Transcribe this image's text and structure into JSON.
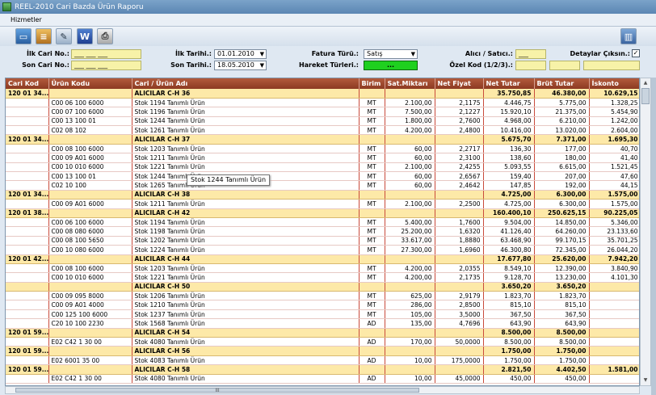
{
  "window": {
    "title": "REEL-2010 Cari Bazda Ürün Raporu"
  },
  "menu": {
    "item": "Hizmetler"
  },
  "filters": {
    "ilk_cari_label": "İlk Cari No.:",
    "ilk_cari_value": "___ ___ ___",
    "son_cari_label": "Son Cari No.:",
    "son_cari_value": "___ ___ ___",
    "ilk_tarih_label": "İlk Tarihi.:",
    "ilk_tarih_value": "01.01.2010",
    "son_tarih_label": "Son Tarihi.:",
    "son_tarih_value": "18.05.2010",
    "fatura_turu_label": "Fatura Türü.:",
    "fatura_turu_value": "Satış",
    "hareket_label": "Hareket Türleri.:",
    "hareket_button": "...",
    "alici_label": "Alıcı / Satıcı.:",
    "alici_value": "___",
    "ozel_kod_label": "Özel Kod (1/2/3).:",
    "detay_label": "Detaylar Çıksın.:",
    "detay_checked": "✓"
  },
  "columns": [
    "Cari Kod",
    "Ürün Kodu",
    "Cari / Ürün Adı",
    "Birim",
    "Sat.Miktarı",
    "Net Fiyat",
    "Net Tutar",
    "Brüt Tutar",
    "İskonto"
  ],
  "rows": [
    {
      "type": "group",
      "cari": "120 01 34...",
      "name": "ALICILAR C-H 36",
      "net": "35.750,85",
      "brut": "46.380,00",
      "isk": "10.629,15"
    },
    {
      "type": "item",
      "code": "C00 06 100 6000",
      "name": "Stok 1194 Tanımlı Ürün",
      "unit": "MT",
      "qty": "2.100,00",
      "price": "2,1175",
      "net": "4.446,75",
      "brut": "5.775,00",
      "isk": "1.328,25"
    },
    {
      "type": "item",
      "code": "C00 07 100 6000",
      "name": "Stok 1196 Tanımlı Ürün",
      "unit": "MT",
      "qty": "7.500,00",
      "price": "2,1227",
      "net": "15.920,10",
      "brut": "21.375,00",
      "isk": "5.454,90"
    },
    {
      "type": "item",
      "code": "C00 13 100 01",
      "name": "Stok 1244 Tanımlı Ürün",
      "unit": "MT",
      "qty": "1.800,00",
      "price": "2,7600",
      "net": "4.968,00",
      "brut": "6.210,00",
      "isk": "1.242,00"
    },
    {
      "type": "item",
      "code": "C02 08 102",
      "name": "Stok 1261 Tanımlı Ürün",
      "unit": "MT",
      "qty": "4.200,00",
      "price": "2,4800",
      "net": "10.416,00",
      "brut": "13.020,00",
      "isk": "2.604,00"
    },
    {
      "type": "group",
      "cari": "120 01 34...",
      "name": "ALICILAR C-H 37",
      "net": "5.675,70",
      "brut": "7.371,00",
      "isk": "1.695,30"
    },
    {
      "type": "item",
      "code": "C00 08 100 6000",
      "name": "Stok 1203 Tanımlı Ürün",
      "unit": "MT",
      "qty": "60,00",
      "price": "2,2717",
      "net": "136,30",
      "brut": "177,00",
      "isk": "40,70"
    },
    {
      "type": "item",
      "code": "C00 09 A01 6000",
      "name": "Stok 1211 Tanımlı Ürün",
      "unit": "MT",
      "qty": "60,00",
      "price": "2,3100",
      "net": "138,60",
      "brut": "180,00",
      "isk": "41,40"
    },
    {
      "type": "item",
      "code": "C00 10 010 6000",
      "name": "Stok 1221 Tanımlı Ürün",
      "unit": "MT",
      "qty": "2.100,00",
      "price": "2,4255",
      "net": "5.093,55",
      "brut": "6.615,00",
      "isk": "1.521,45"
    },
    {
      "type": "item",
      "code": "C00 13 100 01",
      "name": "Stok 1244 Tanımlı Ürün",
      "unit": "MT",
      "qty": "60,00",
      "price": "2,6567",
      "net": "159,40",
      "brut": "207,00",
      "isk": "47,60"
    },
    {
      "type": "item",
      "code": "C02 10 100",
      "name": "Stok 1265 Tanımlı Ürün",
      "unit": "MT",
      "qty": "60,00",
      "price": "2,4642",
      "net": "147,85",
      "brut": "192,00",
      "isk": "44,15"
    },
    {
      "type": "group",
      "cari": "120 01 34...",
      "name": "ALICILAR C-H 38",
      "net": "4.725,00",
      "brut": "6.300,00",
      "isk": "1.575,00"
    },
    {
      "type": "item",
      "code": "C00 09 A01 6000",
      "name": "Stok 1211 Tanımlı Ürün",
      "unit": "MT",
      "qty": "2.100,00",
      "price": "2,2500",
      "net": "4.725,00",
      "brut": "6.300,00",
      "isk": "1.575,00"
    },
    {
      "type": "group",
      "cari": "120 01 38...",
      "name": "ALICILAR C-H 42",
      "net": "160.400,10",
      "brut": "250.625,15",
      "isk": "90.225,05"
    },
    {
      "type": "item",
      "code": "C00 06 100 6000",
      "name": "Stok 1194 Tanımlı Ürün",
      "unit": "MT",
      "qty": "5.400,00",
      "price": "1,7600",
      "net": "9.504,00",
      "brut": "14.850,00",
      "isk": "5.346,00"
    },
    {
      "type": "item",
      "code": "C00 08 080 6000",
      "name": "Stok 1198 Tanımlı Ürün",
      "unit": "MT",
      "qty": "25.200,00",
      "price": "1,6320",
      "net": "41.126,40",
      "brut": "64.260,00",
      "isk": "23.133,60"
    },
    {
      "type": "item",
      "code": "C00 08 100 5650",
      "name": "Stok 1202 Tanımlı Ürün",
      "unit": "MT",
      "qty": "33.617,00",
      "price": "1,8880",
      "net": "63.468,90",
      "brut": "99.170,15",
      "isk": "35.701,25"
    },
    {
      "type": "item",
      "code": "C00 10 080 6000",
      "name": "Stok 1224 Tanımlı Ürün",
      "unit": "MT",
      "qty": "27.300,00",
      "price": "1,6960",
      "net": "46.300,80",
      "brut": "72.345,00",
      "isk": "26.044,20"
    },
    {
      "type": "group",
      "cari": "120 01 42...",
      "name": "ALICILAR C-H 44",
      "net": "17.677,80",
      "brut": "25.620,00",
      "isk": "7.942,20"
    },
    {
      "type": "item",
      "code": "C00 08 100 6000",
      "name": "Stok 1203 Tanımlı Ürün",
      "unit": "MT",
      "qty": "4.200,00",
      "price": "2,0355",
      "net": "8.549,10",
      "brut": "12.390,00",
      "isk": "3.840,90"
    },
    {
      "type": "item",
      "code": "C00 10 010 6000",
      "name": "Stok 1221 Tanımlı Ürün",
      "unit": "MT",
      "qty": "4.200,00",
      "price": "2,1735",
      "net": "9.128,70",
      "brut": "13.230,00",
      "isk": "4.101,30"
    },
    {
      "type": "group",
      "cari": "",
      "name": "ALICILAR C-H 50",
      "net": "3.650,20",
      "brut": "3.650,20",
      "isk": ""
    },
    {
      "type": "item",
      "code": "C00 09 095 8000",
      "name": "Stok 1206 Tanımlı Ürün",
      "unit": "MT",
      "qty": "625,00",
      "price": "2,9179",
      "net": "1.823,70",
      "brut": "1.823,70",
      "isk": ""
    },
    {
      "type": "item",
      "code": "C00 09 A01 4000",
      "name": "Stok 1210 Tanımlı Ürün",
      "unit": "MT",
      "qty": "286,00",
      "price": "2,8500",
      "net": "815,10",
      "brut": "815,10",
      "isk": ""
    },
    {
      "type": "item",
      "code": "C00 125 100 6000",
      "name": "Stok 1237 Tanımlı Ürün",
      "unit": "MT",
      "qty": "105,00",
      "price": "3,5000",
      "net": "367,50",
      "brut": "367,50",
      "isk": ""
    },
    {
      "type": "item",
      "code": "C20 10 100 2230",
      "name": "Stok 1568 Tanımlı Ürün",
      "unit": "AD",
      "qty": "135,00",
      "price": "4,7696",
      "net": "643,90",
      "brut": "643,90",
      "isk": ""
    },
    {
      "type": "group",
      "cari": "120 01 59...",
      "name": "ALICILAR C-H 54",
      "net": "8.500,00",
      "brut": "8.500,00",
      "isk": ""
    },
    {
      "type": "item",
      "code": "E02 C42 1 30 00",
      "name": "Stok 4080 Tanımlı Ürün",
      "unit": "AD",
      "qty": "170,00",
      "price": "50,0000",
      "net": "8.500,00",
      "brut": "8.500,00",
      "isk": ""
    },
    {
      "type": "group",
      "cari": "120 01 59...",
      "name": "ALICILAR C-H 56",
      "net": "1.750,00",
      "brut": "1.750,00",
      "isk": ""
    },
    {
      "type": "item",
      "code": "E02 6001 35 00",
      "name": "Stok 4083 Tanımlı Ürün",
      "unit": "AD",
      "qty": "10,00",
      "price": "175,0000",
      "net": "1.750,00",
      "brut": "1.750,00",
      "isk": ""
    },
    {
      "type": "group",
      "cari": "120 01 59...",
      "name": "ALICILAR C-H 58",
      "net": "2.821,50",
      "brut": "4.402,50",
      "isk": "1.581,00"
    },
    {
      "type": "item",
      "code": "E02 C42 1 30 00",
      "name": "Stok 4080 Tanımlı Ürün",
      "unit": "AD",
      "qty": "10,00",
      "price": "45,0000",
      "net": "450,00",
      "brut": "450,00",
      "isk": ""
    }
  ],
  "tooltip": "Stok 1244 Tanımlı Ürün",
  "scroll": {
    "thumb_label": "III"
  }
}
